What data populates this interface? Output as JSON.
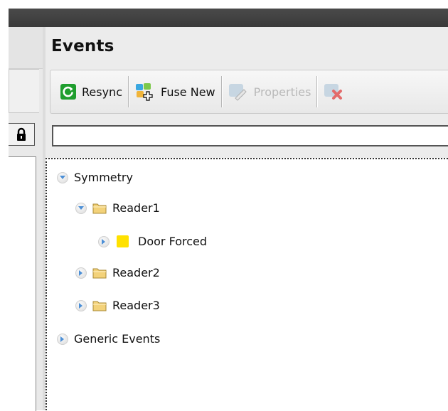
{
  "panel": {
    "title": "Events"
  },
  "toolbar": {
    "resync_label": "Resync",
    "fuse_new_label": "Fuse New",
    "properties_label": "Properties"
  },
  "search": {
    "value": "",
    "placeholder": ""
  },
  "tree": {
    "root": "Symmetry",
    "reader1": "Reader1",
    "door_forced": "Door Forced",
    "reader2": "Reader2",
    "reader3": "Reader3",
    "generic_events": "Generic Events"
  },
  "colors": {
    "title_bar": "#3a3a3a",
    "resync_green": "#1f9e2e",
    "event_swatch": "#ffe100",
    "folder": "#f3d27a"
  }
}
